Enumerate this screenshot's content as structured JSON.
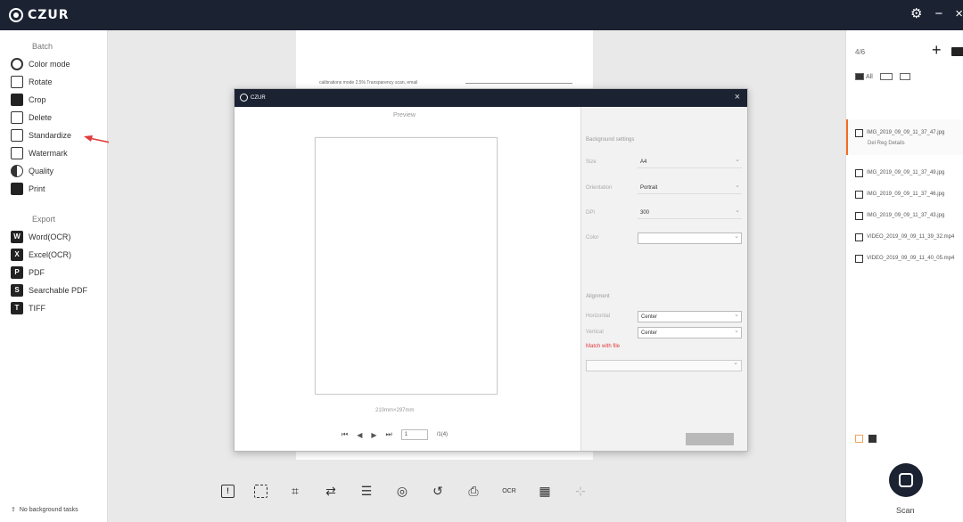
{
  "app": {
    "brand": "CZUR",
    "window_controls": [
      "⚙",
      "−",
      "×"
    ]
  },
  "sidebar": {
    "batch_heading": "Batch",
    "batch_items": [
      {
        "label": "Color mode",
        "icon": "color-mode-icon"
      },
      {
        "label": "Rotate",
        "icon": "rotate-icon"
      },
      {
        "label": "Crop",
        "icon": "crop-icon"
      },
      {
        "label": "Delete",
        "icon": "delete-icon"
      },
      {
        "label": "Standardize",
        "icon": "standardize-icon"
      },
      {
        "label": "Watermark",
        "icon": "watermark-icon"
      },
      {
        "label": "Quality",
        "icon": "quality-icon"
      },
      {
        "label": "Print",
        "icon": "print-icon"
      }
    ],
    "export_heading": "Export",
    "export_items": [
      {
        "label": "Word(OCR)",
        "icon": "word-icon"
      },
      {
        "label": "Excel(OCR)",
        "icon": "excel-icon"
      },
      {
        "label": "PDF",
        "icon": "pdf-icon"
      },
      {
        "label": "Searchable PDF",
        "icon": "searchable-pdf-icon"
      },
      {
        "label": "TIFF",
        "icon": "tiff-icon"
      }
    ],
    "bottom_text": "No background tasks"
  },
  "workspace": {
    "page_snippet": "calibrations mode 2.5% Transparency scan, email",
    "toolbar_icons": [
      "info-icon",
      "select-icon",
      "crop-icon",
      "swap-icon",
      "adjust-icon",
      "color-icon",
      "undo-icon",
      "print-icon",
      "ocr-icon",
      "grid-icon",
      "split-icon"
    ],
    "toolbar_ocr_label": "OCR"
  },
  "right_panel": {
    "count": "4/6",
    "filters": [
      "All"
    ],
    "files": [
      {
        "name": "IMG_2019_09_09_11_37_47.jpg",
        "checked": true,
        "active": true,
        "actions": "Del  Reg  Details"
      },
      {
        "name": "IMG_2019_09_09_11_37_49.jpg",
        "checked": true
      },
      {
        "name": "IMG_2019_09_09_11_37_46.jpg",
        "checked": true
      },
      {
        "name": "IMG_2019_09_09_11_37_43.jpg",
        "checked": true
      },
      {
        "name": "VIDEO_2019_09_09_11_39_32.mp4",
        "checked": false
      },
      {
        "name": "VIDEO_2019_09_09_11_40_05.mp4",
        "checked": false
      }
    ],
    "scan_label": "Scan"
  },
  "dialog": {
    "title": "CZUR",
    "close": "×",
    "preview_label": "Preview",
    "page_size_label": "210mm×297mm",
    "pager": {
      "first": "⏮",
      "prev": "◀",
      "next": "▶",
      "last": "⏭",
      "current": "1",
      "total": "/1(4)"
    },
    "settings": {
      "background_heading": "Background settings",
      "size_label": "Size",
      "size_value": "A4",
      "orientation_label": "Orientation",
      "orientation_value": "Portrait",
      "dpi_label": "DPI",
      "dpi_value": "300",
      "color_label": "Color",
      "color_value": "",
      "alignment_heading": "Alignment",
      "horizontal_label": "Horizontal",
      "horizontal_value": "Center",
      "vertical_label": "Vertical",
      "vertical_value": "Center",
      "match_link": "Match with file",
      "ok_label": ""
    }
  }
}
